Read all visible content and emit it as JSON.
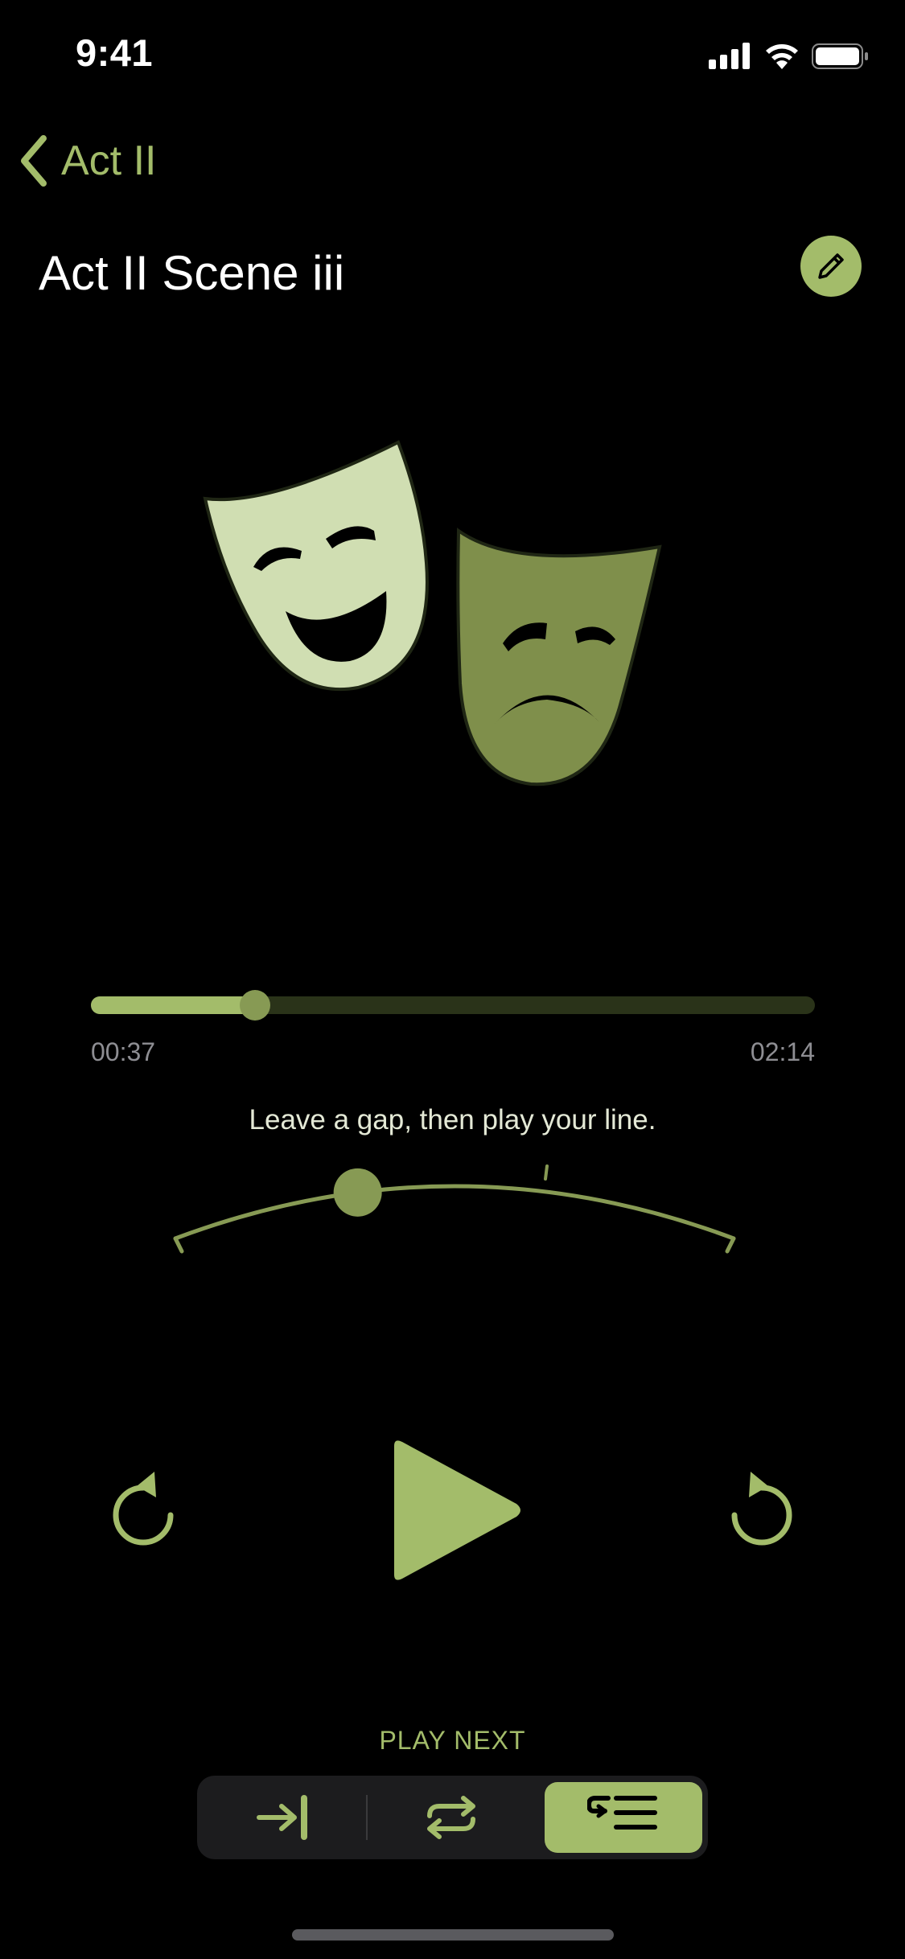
{
  "status_bar": {
    "time": "9:41",
    "icons": [
      "cellular-signal-icon",
      "wifi-icon",
      "battery-icon"
    ]
  },
  "nav": {
    "back_label": "Act II",
    "back_icon": "chevron-left-icon"
  },
  "header": {
    "title": "Act II Scene iii",
    "edit_icon": "pencil-icon"
  },
  "artwork": {
    "icon": "theater-masks-icon"
  },
  "player": {
    "progress_fraction": 0.227,
    "elapsed": "00:37",
    "duration": "02:14",
    "hint": "Leave a gap, then play your line.",
    "gap_fraction": 0.33,
    "skip_back_icon": "rewind-icon",
    "play_icon": "play-icon",
    "skip_forward_icon": "fast-forward-icon"
  },
  "play_next": {
    "label": "PLAY NEXT",
    "options": [
      {
        "icon": "skip-to-end-icon",
        "selected": false
      },
      {
        "icon": "repeat-icon",
        "selected": false
      },
      {
        "icon": "queue-list-icon",
        "selected": true
      }
    ]
  },
  "colors": {
    "accent": "#a3bc6a",
    "accent_dark": "#879a54",
    "track": "#2a3319",
    "background": "#000000",
    "secondary_text": "#8e8e93"
  }
}
